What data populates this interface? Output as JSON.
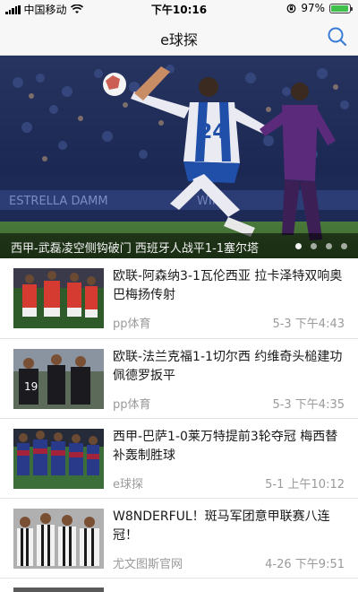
{
  "status_bar": {
    "carrier": "中国移动",
    "time": "下午10:16",
    "battery_pct": "97%",
    "battery_level": 0.97,
    "icons": [
      "signal-icon",
      "wifi-icon",
      "orientation-lock-icon",
      "battery-icon"
    ]
  },
  "nav": {
    "title": "e球探",
    "search_icon": "search-icon"
  },
  "hero": {
    "caption": "西甲-武磊凌空侧钩破门 西班牙人战平1-1塞尔塔",
    "slide_count": 4,
    "active_slide": 1
  },
  "news": [
    {
      "title": "欧联-阿森纳3-1瓦伦西亚 拉卡泽特双响奥巴梅扬传射",
      "source": "pp体育",
      "time": "5-3 下午4:43"
    },
    {
      "title": "欧联-法兰克福1-1切尔西 约维奇头槌建功佩德罗扳平",
      "source": "pp体育",
      "time": "5-3 下午4:35"
    },
    {
      "title": "西甲-巴萨1-0莱万特提前3轮夺冠 梅西替补轰制胜球",
      "source": "e球探",
      "time": "5-1 上午10:12"
    },
    {
      "title": "W8NDERFUL！斑马军团意甲联赛八连冠！",
      "source": "尤文图斯官网",
      "time": "4-26 下午9:51"
    }
  ],
  "colors": {
    "accent_blue": "#3a7bd5",
    "battery_green": "#3fc04a",
    "meta_gray": "#9a9a9a"
  }
}
